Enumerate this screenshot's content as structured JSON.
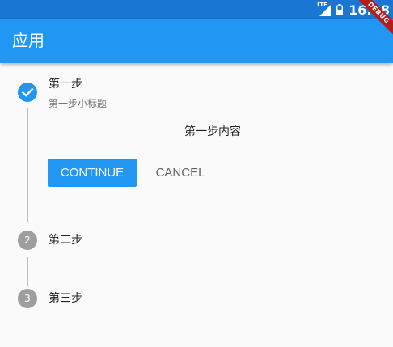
{
  "status_bar": {
    "network": "LTE",
    "time": "16:38",
    "background_color": "#1976d2"
  },
  "debug_banner": "DEBUG",
  "app_bar": {
    "title": "应用",
    "background_color": "#2196f3"
  },
  "stepper": {
    "steps": [
      {
        "number": "1",
        "title": "第一步",
        "subtitle": "第一步小标题",
        "content": "第一步内容",
        "state": "complete",
        "icon": "check-icon"
      },
      {
        "number": "2",
        "title": "第二步",
        "state": "inactive"
      },
      {
        "number": "3",
        "title": "第三步",
        "state": "inactive"
      }
    ],
    "continue_label": "CONTINUE",
    "cancel_label": "CANCEL",
    "accent_color": "#2196f3",
    "inactive_color": "#9e9e9e"
  }
}
